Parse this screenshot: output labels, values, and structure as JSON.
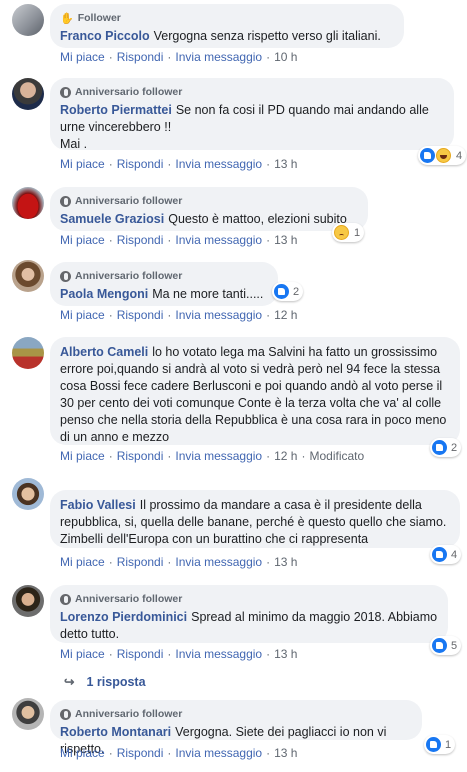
{
  "actions": {
    "like": "Mi piace",
    "reply": "Rispondi",
    "message": "Invia messaggio",
    "edited": "Modificato"
  },
  "comments": [
    {
      "badge": "Follower",
      "author": "Franco Piccolo",
      "text": "Vergogna senza rispetto verso gli italiani.",
      "time": "10 h"
    },
    {
      "badge": "Anniversario follower",
      "author": "Roberto Piermattei",
      "text": "Se non fa cosi il PD quando mai andando alle urne vincerebbero !!",
      "text2": "Mai .",
      "time": "13 h",
      "reactions": "4"
    },
    {
      "badge": "Anniversario follower",
      "author": "Samuele Graziosi",
      "text": "Questo è mattoo, elezioni subito",
      "time": "13 h",
      "reactions": "1"
    },
    {
      "badge": "Anniversario follower",
      "author": "Paola Mengoni",
      "text": "Ma ne more tanti.....",
      "time": "12 h",
      "reactions": "2"
    },
    {
      "badge": "",
      "author": "Alberto Cameli",
      "text": "lo ho votato lega ma Salvini ha fatto un grossissimo errore poi,quando si andrà al voto si vedrà però nel 94 fece la stessa cosa Bossi fece cadere Berlusconi e poi quando andò al voto perse il 30 per cento dei voti comunque Conte è la terza volta che va' al colle penso che nella storia della Repubblica è una cosa rara in poco meno di un anno e mezzo",
      "time": "12 h",
      "reactions": "2"
    },
    {
      "badge": "",
      "author": "Fabio Vallesi",
      "text": "Il prossimo da mandare a casa è il presidente della repubblica, si, quella delle banane, perché è questo quello che siamo. Zimbelli dell'Europa con un burattino che ci rappresenta",
      "time": "13 h",
      "reactions": "4"
    },
    {
      "badge": "Anniversario follower",
      "author": "Lorenzo Pierdominici",
      "text": "Spread al minimo da maggio 2018. Abbiamo detto tutto.",
      "time": "13 h",
      "reactions": "5"
    },
    {
      "badge": "Anniversario follower",
      "author": "Roberto Montanari",
      "text": "Vergogna. Siete dei pagliacci io non vi rispetto.",
      "time": "13 h",
      "reactions": "1"
    }
  ],
  "reply_count_label": "1 risposta"
}
